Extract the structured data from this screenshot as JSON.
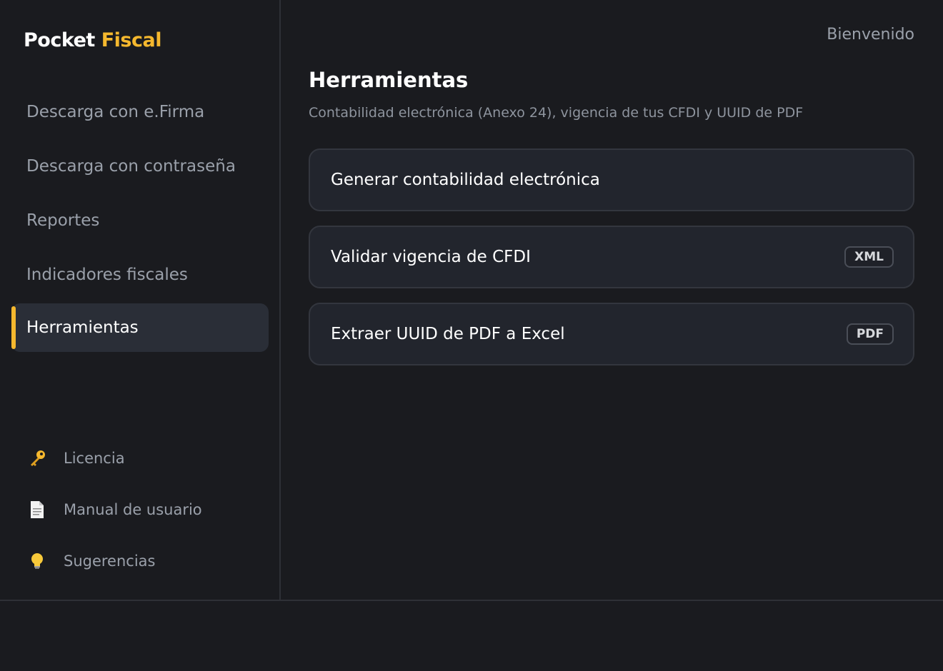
{
  "app": {
    "logo_part1": "Pocket",
    "logo_part2": "Fiscal",
    "accent_color": "#f5b82e"
  },
  "sidebar": {
    "nav_items": [
      {
        "label": "Descarga con e.Firma",
        "active": false
      },
      {
        "label": "Descarga con contraseña",
        "active": false
      },
      {
        "label": "Reportes",
        "active": false
      },
      {
        "label": "Indicadores fiscales",
        "active": false
      },
      {
        "label": "Herramientas",
        "active": true
      }
    ],
    "bottom_items": [
      {
        "label": "Licencia",
        "icon": "key-icon"
      },
      {
        "label": "Manual de usuario",
        "icon": "document-icon"
      },
      {
        "label": "Sugerencias",
        "icon": "lightbulb-icon"
      }
    ]
  },
  "header": {
    "welcome": "Bienvenido"
  },
  "main": {
    "title": "Herramientas",
    "subtitle": "Contabilidad electrónica (Anexo 24), vigencia de tus CFDI y UUID de PDF",
    "cards": [
      {
        "label": "Generar contabilidad electrónica",
        "badge": ""
      },
      {
        "label": "Validar vigencia de CFDI",
        "badge": "XML"
      },
      {
        "label": "Extraer UUID de PDF a Excel",
        "badge": "PDF"
      }
    ]
  }
}
